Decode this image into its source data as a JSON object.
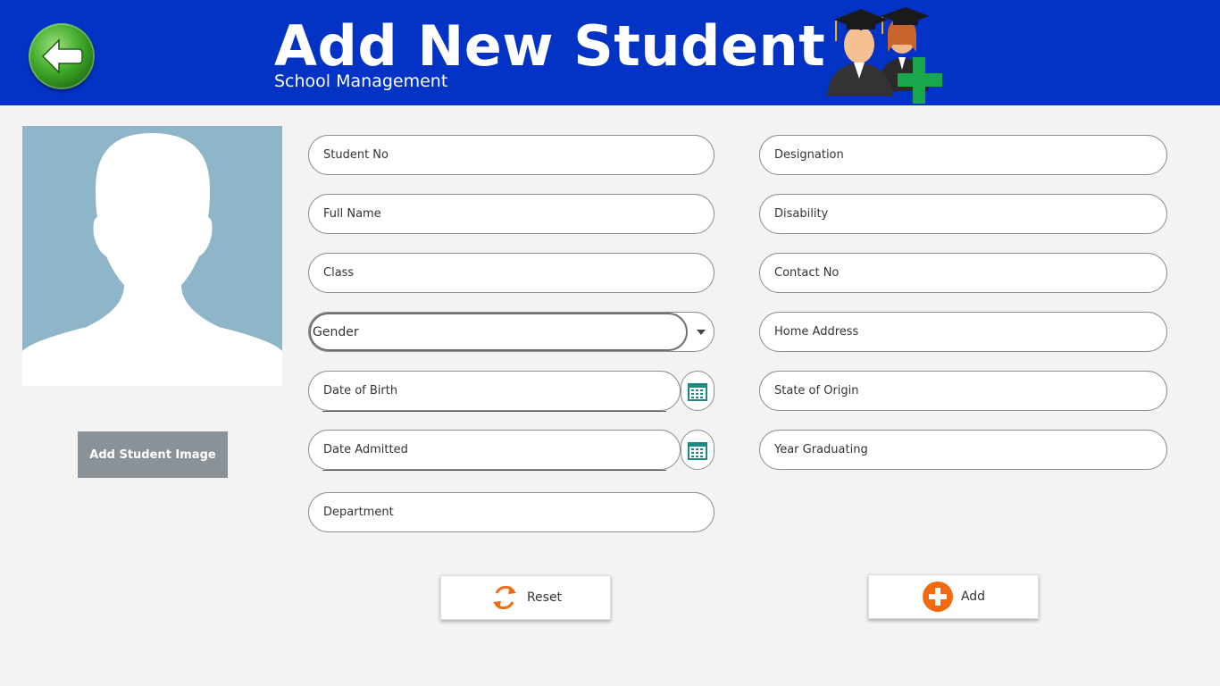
{
  "header": {
    "title": "Add New Student",
    "subtitle": "School Management",
    "back_icon": "back-arrow-icon",
    "logo_icon": "graduates-add-icon"
  },
  "photo": {
    "placeholder_icon": "person-silhouette-icon",
    "add_image_label": "Add Student Image"
  },
  "form": {
    "left": {
      "student_no": "Student No",
      "full_name": "Full Name",
      "class": "Class",
      "gender": "Gender",
      "date_of_birth": "Date of Birth",
      "date_admitted": "Date Admitted",
      "department": "Department"
    },
    "right": {
      "designation": "Designation",
      "disability": "Disability",
      "contact_no": "Contact No",
      "home_address": "Home Address",
      "state_of_origin": "State of Origin",
      "year_graduating": "Year Graduating"
    }
  },
  "actions": {
    "reset_label": "Reset",
    "add_label": "Add"
  },
  "colors": {
    "header_bg": "#0333c4",
    "accent_orange": "#f26a10",
    "calendar_teal": "#1b8a86",
    "button_gray": "#8a9197"
  }
}
